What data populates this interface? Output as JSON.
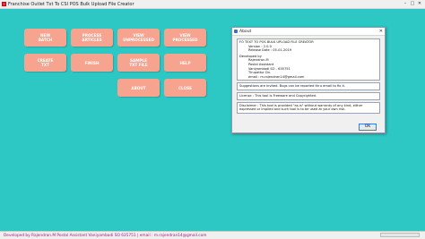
{
  "window": {
    "title": "Franchise Outlet Txt To CSI POS Bulk Upload File Creator",
    "controls": [
      "–",
      "□",
      "✕"
    ]
  },
  "menu_buttons": [
    "NEW\nBATCH",
    "PROCESS\nARTICLES",
    "VIEW\nUNPROCESSED",
    "VIEW\nPROCESSED",
    "CREATE\nTXT",
    "FINISH",
    "SAMPLE\nTXT FILE",
    "HELP",
    "ABOUT",
    "CLOSE"
  ],
  "about_dialog": {
    "title": "About",
    "close_glyph": "✕",
    "app_info": [
      "FO TEXT TO POS BULK UPLOAD FILE CREATOR",
      "Version : 2.0.0",
      "Release Date : 05-01-2019"
    ],
    "developer_info": [
      "Developed by",
      "Rajendran.M",
      "Postal Assistant",
      "Vaniyambadi SO - 635751",
      "Tirupattur Dn.",
      "email : m.rajendran14@gmail.com"
    ],
    "suggestions": "Suggestions are invited. Bugs can be reported thru email to fix it.",
    "license": "License : This tool is Freeware and Copyrighted.",
    "disclaimer": "Disclaimer : This tool is provided \"as-is\" without warranty of any kind, either expressed or implied and such tool is to be used at your own risk.",
    "ok_label": "OK"
  },
  "status_bar": {
    "text": "Developed by Rajendran.M Postal Assistant Vaniyambadi SO 635751  |  email : m.rajendran14@gmail.com"
  },
  "colors": {
    "background": "#2ec8c4",
    "button": "#f6a38f",
    "status_text": "#b0108c"
  }
}
